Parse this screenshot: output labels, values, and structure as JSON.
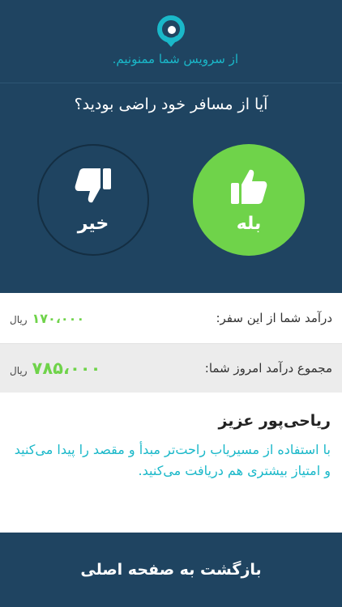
{
  "header": {
    "logo_icon": "map-pin-icon",
    "thanks_text": "از سرویس شما ممنونیم."
  },
  "rating": {
    "question": "آیا از مسافر خود راضی بودید؟",
    "yes": {
      "label": "بله",
      "icon": "thumbs-up-icon",
      "color": "#6fd34a"
    },
    "no": {
      "label": "خیر",
      "icon": "thumbs-down-icon"
    }
  },
  "income": {
    "trip_label": "درآمد شما از این سفر:",
    "trip_amount": "۱۷۰،۰۰۰",
    "total_label": "مجموع درآمد امروز شما:",
    "total_amount": "۷۸۵،۰۰۰",
    "currency": "ریال"
  },
  "message": {
    "name": "ریاحی‌پور عزیز",
    "body": "با استفاده از مسیریاب راحت‌تر مبدأ و مقصد را پیدا می‌کنید و امتیاز بیشتری هم دریافت می‌کنید."
  },
  "footer": {
    "back_label": "بازگشت به صفحه اصلی"
  },
  "colors": {
    "background": "#1f4461",
    "accent_green": "#6fd34a",
    "accent_teal": "#1ab8c9"
  }
}
